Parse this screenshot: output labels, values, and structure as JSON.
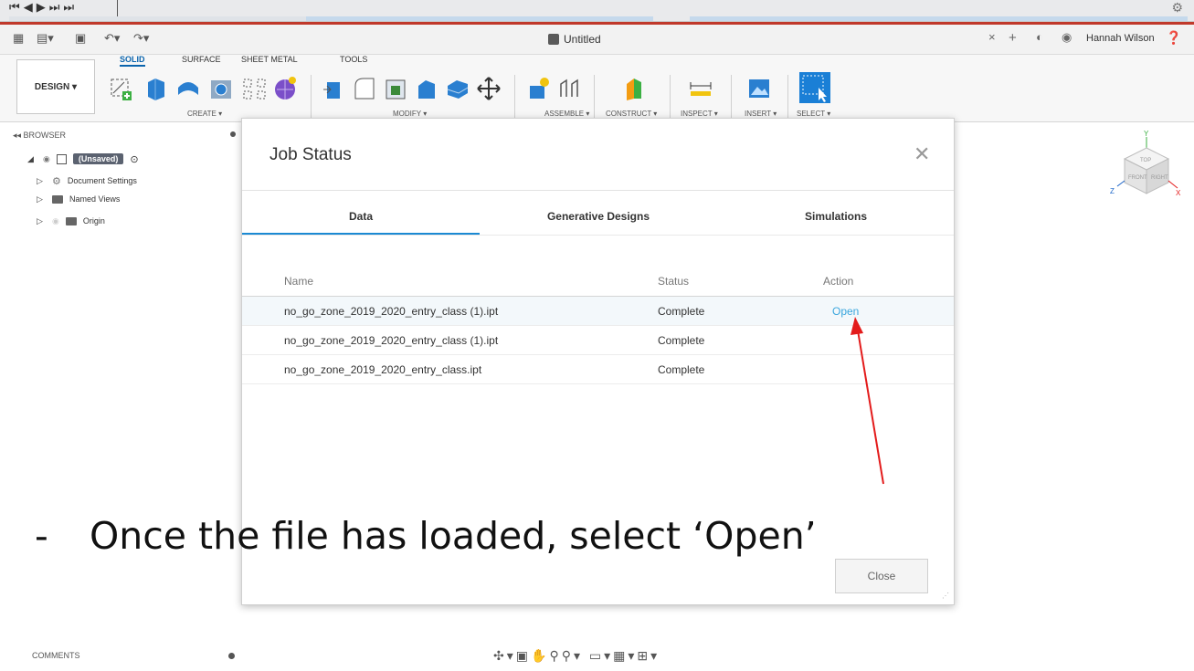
{
  "app": {
    "doc_title": "Untitled",
    "user_name": "Hannah Wilson"
  },
  "ribbon": {
    "workspace": "DESIGN ▾",
    "tabs": [
      "SOLID",
      "SURFACE",
      "SHEET METAL",
      "TOOLS"
    ],
    "groups": [
      "CREATE ▾",
      "MODIFY ▾",
      "ASSEMBLE ▾",
      "CONSTRUCT ▾",
      "INSPECT ▾",
      "INSERT ▾",
      "SELECT ▾"
    ]
  },
  "browser": {
    "title": "BROWSER",
    "root_label": "(Unsaved)",
    "items": [
      "Document Settings",
      "Named Views",
      "Origin"
    ]
  },
  "viewcube": {
    "top": "TOP",
    "front": "FRONT",
    "right": "RIGHT",
    "z": "Z",
    "x": "X",
    "y": "Y"
  },
  "bottom": {
    "comments": "COMMENTS"
  },
  "modal": {
    "title": "Job Status",
    "tabs": [
      "Data",
      "Generative Designs",
      "Simulations"
    ],
    "columns": [
      "Name",
      "Status",
      "Action"
    ],
    "rows": [
      {
        "name": "no_go_zone_2019_2020_entry_class (1).ipt",
        "status": "Complete",
        "action": "Open"
      },
      {
        "name": "no_go_zone_2019_2020_entry_class (1).ipt",
        "status": "Complete",
        "action": ""
      },
      {
        "name": "no_go_zone_2019_2020_entry_class.ipt",
        "status": "Complete",
        "action": ""
      }
    ],
    "close_label": "Close"
  },
  "annotation": {
    "bullet": "-",
    "text": "Once the file has loaded, select ‘Open’",
    "arrow_color": "#e31b1b"
  }
}
